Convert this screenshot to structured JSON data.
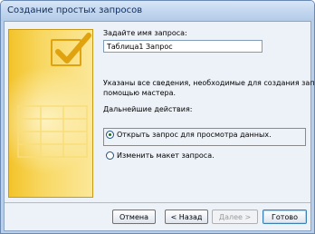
{
  "window": {
    "title": "Создание простых запросов"
  },
  "form": {
    "name_label": "Задайте имя запроса:",
    "name_value": "Таблица1 Запрос",
    "info_text_line1": "Указаны все сведения, необходимые для создания запроса с",
    "info_text_line2": "помощью мастера.",
    "next_actions_label": "Дальнейшие действия:",
    "options": [
      {
        "label": "Открыть запрос для просмотра данных.",
        "selected": true
      },
      {
        "label": "Изменить макет запроса.",
        "selected": false
      }
    ]
  },
  "buttons": {
    "cancel": "Отмена",
    "back": "< Назад",
    "next": "Далее >",
    "finish": "Готово"
  },
  "colors": {
    "accent": "#f3c32a",
    "frame": "#b9cfe9",
    "client": "#edf2f9"
  }
}
